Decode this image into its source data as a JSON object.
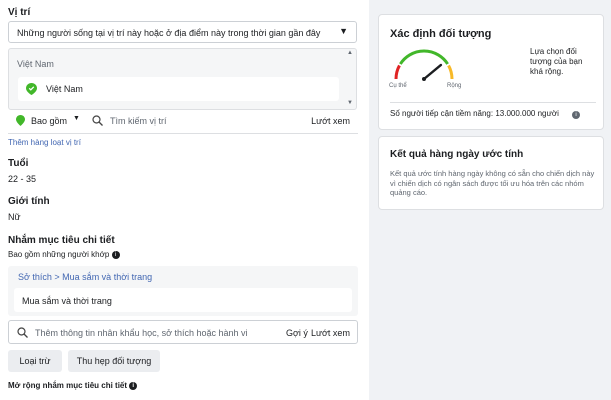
{
  "location": {
    "section_title": "Vị trí",
    "dropdown_value": "Những người sống tại vị trí này hoặc ở địa điểm này trong thời gian gần đây",
    "country_header": "Việt Nam",
    "selected_location": "Việt Nam",
    "include_label": "Bao gồm",
    "search_placeholder": "Tìm kiếm vị trí",
    "browse_label": "Lướt xem",
    "bulk_add_link": "Thêm hàng loạt vị trí"
  },
  "age": {
    "title": "Tuổi",
    "value": "22 - 35"
  },
  "gender": {
    "title": "Giới tính",
    "value": "Nữ"
  },
  "detailed_targeting": {
    "title": "Nhắm mục tiêu chi tiết",
    "include_label": "Bao gồm những người khớp",
    "breadcrumb": "Sở thích > Mua sắm và thời trang",
    "selected_interest": "Mua sắm và thời trang",
    "search_placeholder": "Thêm thông tin nhân khẩu học, sở thích hoặc hành vi",
    "suggest_label": "Gợi ý",
    "browse_label": "Lướt xem",
    "exclude_button": "Loại trừ",
    "narrow_button": "Thu hẹp đối tượng",
    "expand_label": "Mở rộng nhắm mục tiêu chi tiết"
  },
  "audience_definition": {
    "title": "Xác định đối tượng",
    "gauge_label_left": "Cụ thể",
    "gauge_label_right": "Rộng",
    "description": "Lựa chọn đối tượng của bạn khá rộng.",
    "potential_reach": "Số người tiếp cận tiềm năng: 13.000.000 người",
    "gauge_level": 0.78,
    "colors": {
      "red": "#e02424",
      "green": "#42b72a",
      "orange": "#f7b928"
    }
  },
  "daily_results": {
    "title": "Kết quả hàng ngày ước tính",
    "description": "Kết quả ước tính hàng ngày không có sẵn cho chiến dịch này vì chiến dịch có ngân sách được tối ưu hóa trên các nhóm quảng cáo."
  }
}
